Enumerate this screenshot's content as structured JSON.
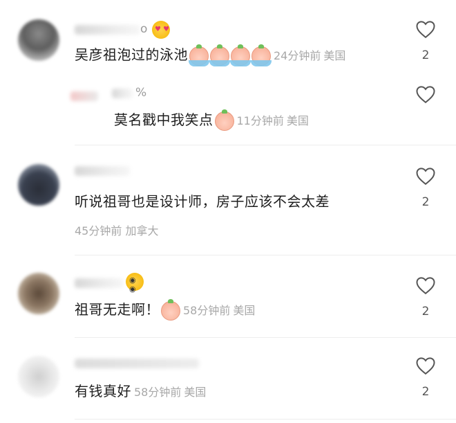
{
  "comments": [
    {
      "username_suffix": "o",
      "text": "吴彦祖泡过的泳池",
      "time": "24分钟前",
      "location": "美国",
      "likes": "2",
      "icons": [
        "heart-face-emoji",
        "peach-swimming-emoji"
      ]
    },
    {
      "username_suffix": "%",
      "text": "莫名戳中我笑点",
      "time": "11分钟前",
      "location": "美国",
      "likes": "",
      "icons": [
        "peach-laughing-emoji"
      ]
    },
    {
      "username_suffix": "",
      "text": "听说祖哥也是设计师，房子应该不会太差",
      "time": "45分钟前",
      "location": "加拿大",
      "likes": "2"
    },
    {
      "username_suffix": "",
      "text": "祖哥无走啊！",
      "time": "58分钟前",
      "location": "美国",
      "likes": "2",
      "icons": [
        "zany-face-emoji",
        "peach-crying-emoji"
      ]
    },
    {
      "username_suffix": "",
      "text": "有钱真好",
      "time": "58分钟前",
      "location": "美国",
      "likes": "2"
    }
  ],
  "colors": {
    "text": "#1e1e1e",
    "meta": "#a8a8a8",
    "like_outline": "#555555"
  }
}
